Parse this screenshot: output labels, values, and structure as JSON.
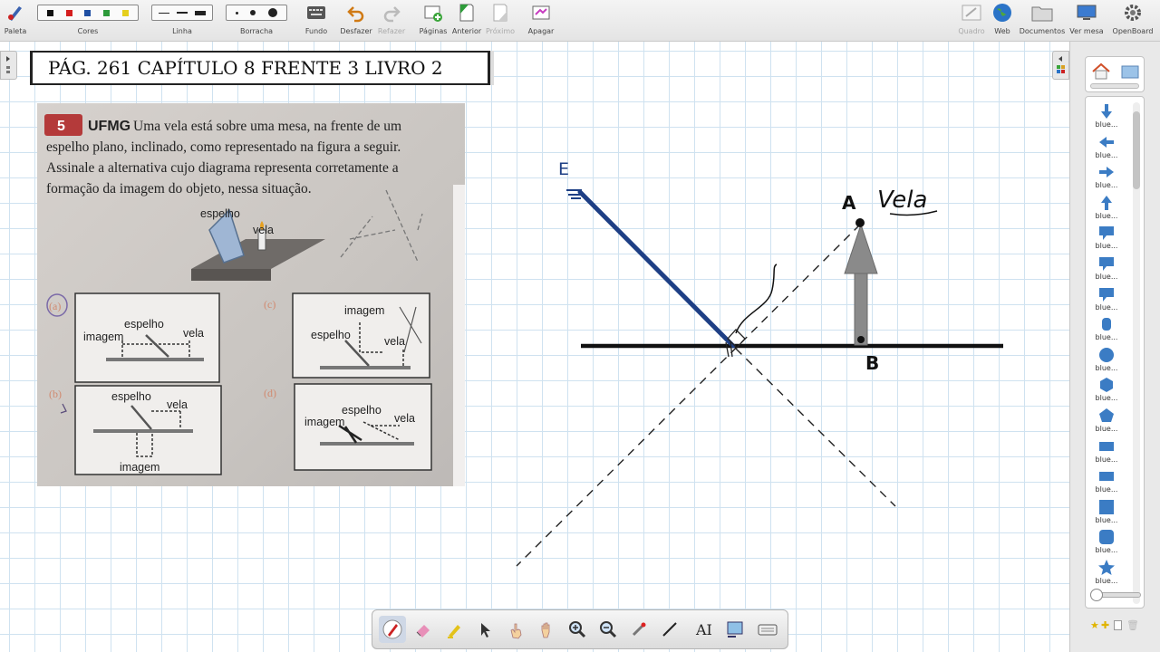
{
  "toolbar": {
    "items": [
      {
        "label": "Paleta",
        "icon": "palette-pen-icon"
      },
      {
        "label": "Cores",
        "icon": "color-swatches"
      },
      {
        "label": "Linha",
        "icon": "line-width"
      },
      {
        "label": "Borracha",
        "icon": "eraser-size"
      },
      {
        "label": "Fundo",
        "icon": "keyboard-icon"
      },
      {
        "label": "Desfazer",
        "icon": "undo-icon"
      },
      {
        "label": "Refazer",
        "icon": "redo-icon",
        "disabled": true
      },
      {
        "label": "Páginas",
        "icon": "add-page-icon"
      },
      {
        "label": "Anterior",
        "icon": "previous-page-icon"
      },
      {
        "label": "Próximo",
        "icon": "next-page-icon",
        "disabled": true
      },
      {
        "label": "Apagar",
        "icon": "clear-page-icon"
      },
      {
        "label": "Quadro",
        "icon": "board-icon",
        "disabled": true
      },
      {
        "label": "Web",
        "icon": "globe-icon"
      },
      {
        "label": "Documentos",
        "icon": "folder-icon"
      },
      {
        "label": "Ver mesa",
        "icon": "desktop-icon"
      },
      {
        "label": "OpenBoard",
        "icon": "gear-icon"
      }
    ],
    "colors": [
      "#111111",
      "#d51e1e",
      "#1f4fa3",
      "#2c9a3a",
      "#e5cf1c"
    ]
  },
  "board": {
    "title": "PÁG. 261  CAPÍTULO 8  FRENTE 3 LIVRO 2",
    "photo": {
      "question_number": "5",
      "source": "UFMG",
      "question_text": [
        "Uma vela está sobre uma mesa, na frente de um",
        "espelho plano, inclinado, como representado na figura a seguir.",
        "Assinale a alternativa cujo diagrama representa corretamente a",
        "formação da imagem do objeto, nessa situação."
      ],
      "figure_labels": {
        "mirror": "espelho",
        "candle": "vela"
      },
      "options": [
        {
          "letter": "(a)",
          "labels": [
            "espelho",
            "imagem",
            "vela"
          ]
        },
        {
          "letter": "(b)",
          "labels": [
            "espelho",
            "vela",
            "imagem"
          ]
        },
        {
          "letter": "(c)",
          "labels": [
            "imagem",
            "espelho",
            "vela"
          ]
        },
        {
          "letter": "(d)",
          "labels": [
            "espelho",
            "imagem",
            "vela"
          ]
        }
      ]
    },
    "drawing": {
      "mirror_label": "E",
      "point_a": "A",
      "candle_label": "Vela",
      "point_b": "B"
    }
  },
  "library": {
    "items": [
      {
        "label": "blue...",
        "icon": "arrow-down-icon"
      },
      {
        "label": "blue...",
        "icon": "arrow-left-icon"
      },
      {
        "label": "blue...",
        "icon": "arrow-right-icon"
      },
      {
        "label": "blue...",
        "icon": "arrow-up-icon"
      },
      {
        "label": "blue...",
        "icon": "speech-bubble-icon"
      },
      {
        "label": "blue...",
        "icon": "speech-bubble-icon"
      },
      {
        "label": "blue...",
        "icon": "speech-bubble-icon"
      },
      {
        "label": "blue...",
        "icon": "cylinder-icon"
      },
      {
        "label": "blue...",
        "icon": "circle-icon"
      },
      {
        "label": "blue...",
        "icon": "hexagon-icon"
      },
      {
        "label": "blue...",
        "icon": "pentagon-icon"
      },
      {
        "label": "blue...",
        "icon": "rectangle-icon"
      },
      {
        "label": "blue...",
        "icon": "rectangle-icon"
      },
      {
        "label": "blue...",
        "icon": "square-icon"
      },
      {
        "label": "blue...",
        "icon": "rounded-square-icon"
      },
      {
        "label": "blue...",
        "icon": "star-icon"
      }
    ]
  },
  "dock": {
    "tools": [
      "pen-icon",
      "eraser-icon",
      "highlighter-icon",
      "select-arrow-icon",
      "interact-hand-icon",
      "pan-hand-icon",
      "zoom-in-icon",
      "zoom-out-icon",
      "laser-pointer-icon",
      "line-icon",
      "text-icon",
      "capture-icon",
      "virtual-keyboard-icon"
    ]
  }
}
